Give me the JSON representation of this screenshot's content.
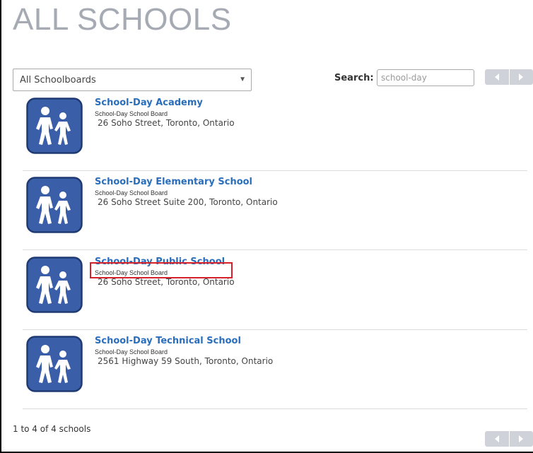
{
  "page": {
    "title": "ALL SCHOOLS"
  },
  "filters": {
    "schoolboard_select": {
      "selected": "All Schoolboards"
    },
    "search": {
      "label": "Search:",
      "value": "school-day"
    }
  },
  "icons": {
    "school_icon": "school-children-icon",
    "prev": "chevron-left-icon",
    "next": "chevron-right-icon",
    "select_caret": "caret-down-icon"
  },
  "colors": {
    "title": "#a5aab3",
    "link": "#2a6ebb",
    "icon_fill": "#3a5fa8",
    "highlight": "#d6212b",
    "pager": "#cfd3d9"
  },
  "schools": [
    {
      "name": "School-Day Academy",
      "board": "School-Day School Board",
      "address": "26 Soho Street, Toronto, Ontario"
    },
    {
      "name": "School-Day Elementary School",
      "board": "School-Day School Board",
      "address": "26 Soho Street Suite 200, Toronto, Ontario"
    },
    {
      "name": "School-Day Public School",
      "board": "School-Day School Board",
      "address": "26 Soho Street, Toronto, Ontario"
    },
    {
      "name": "School-Day Technical School",
      "board": "School-Day School Board",
      "address": "2561 Highway 59 South, Toronto, Ontario"
    }
  ],
  "footer": {
    "summary": "1 to 4 of 4 schools"
  }
}
